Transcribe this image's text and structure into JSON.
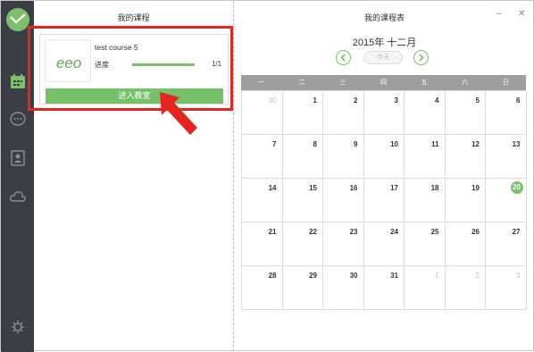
{
  "sidebar": {
    "icons": [
      "check-logo-icon",
      "calendar-icon",
      "chat-icon",
      "contacts-icon",
      "cloud-icon",
      "settings-icon"
    ]
  },
  "course_panel": {
    "title": "我的课程",
    "course": {
      "name": "test course 5",
      "thumbnail_text": "eeo",
      "progress_label": "进度",
      "progress_text": "1/1",
      "progress_fraction": 1.0,
      "enter_label": "进入教室"
    }
  },
  "schedule_panel": {
    "title": "我的课程表",
    "minimize": "–",
    "close": "✕",
    "month": "2015年 十二月",
    "today_label": "今天",
    "weekdays": [
      "一",
      "二",
      "三",
      "四",
      "五",
      "六",
      "日"
    ],
    "weeks": [
      [
        {
          "d": "30",
          "m": true
        },
        {
          "d": "1"
        },
        {
          "d": "2"
        },
        {
          "d": "3"
        },
        {
          "d": "4"
        },
        {
          "d": "5"
        },
        {
          "d": "6"
        }
      ],
      [
        {
          "d": "7"
        },
        {
          "d": "8"
        },
        {
          "d": "9"
        },
        {
          "d": "10"
        },
        {
          "d": "11"
        },
        {
          "d": "12"
        },
        {
          "d": "13"
        }
      ],
      [
        {
          "d": "14"
        },
        {
          "d": "15"
        },
        {
          "d": "16"
        },
        {
          "d": "17"
        },
        {
          "d": "18"
        },
        {
          "d": "19"
        },
        {
          "d": "20",
          "t": true
        }
      ],
      [
        {
          "d": "21"
        },
        {
          "d": "22"
        },
        {
          "d": "23"
        },
        {
          "d": "24"
        },
        {
          "d": "25"
        },
        {
          "d": "26"
        },
        {
          "d": "27"
        }
      ],
      [
        {
          "d": "28"
        },
        {
          "d": "29"
        },
        {
          "d": "30"
        },
        {
          "d": "31"
        },
        {
          "d": "1",
          "m": true
        },
        {
          "d": "2",
          "m": true
        },
        {
          "d": "3",
          "m": true
        }
      ]
    ]
  },
  "colors": {
    "accent": "#7cbf6d",
    "sidebar": "#3b3e44",
    "highlight": "#e5261f"
  }
}
